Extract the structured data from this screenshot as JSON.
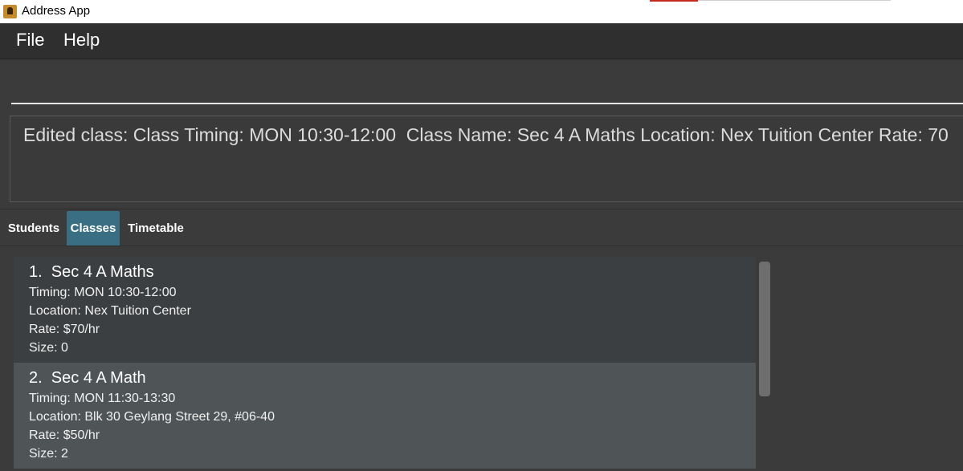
{
  "window": {
    "title": "Address App"
  },
  "menu": {
    "file_label": "File",
    "help_label": "Help"
  },
  "command": {
    "value": ""
  },
  "result": {
    "message": "Edited class: Class Timing: MON 10:30-12:00  Class Name: Sec 4 A Maths Location: Nex Tuition Center Rate: 70"
  },
  "tabs": [
    {
      "label": "Students",
      "selected": false
    },
    {
      "label": "Classes",
      "selected": true
    },
    {
      "label": "Timetable",
      "selected": false
    }
  ],
  "classes": [
    {
      "title": "1.  Sec 4 A Maths",
      "timing": "Timing: MON 10:30-12:00",
      "location": "Location: Nex Tuition Center",
      "rate": "Rate: $70/hr",
      "size": "Size: 0"
    },
    {
      "title": "2.  Sec 4 A Math",
      "timing": "Timing: MON 11:30-13:30",
      "location": "Location: Blk 30 Geylang Street 29, #06-40",
      "rate": "Rate: $50/hr",
      "size": "Size: 2"
    }
  ],
  "colors": {
    "selected_tab": "#3a6e82",
    "background": "#3b3b3b",
    "selected_card": "#4f5557"
  },
  "icons": {
    "app": "address-book-icon"
  }
}
